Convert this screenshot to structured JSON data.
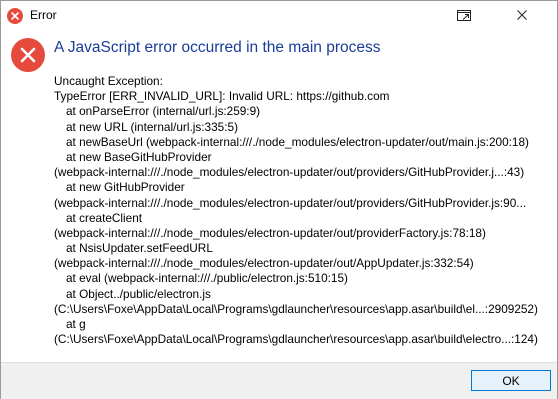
{
  "window": {
    "title": "Error",
    "accent_color": "#e64a3c"
  },
  "dialog": {
    "heading": "A JavaScript error occurred in the main process",
    "heading_color": "#1a3c99",
    "lines": [
      "Uncaught Exception:",
      "TypeError [ERR_INVALID_URL]: Invalid URL: https://github.com",
      "at onParseError (internal/url.js:259:9)",
      "at new URL (internal/url.js:335:5)",
      "at newBaseUrl (webpack-internal:///./node_modules/electron-updater/out/main.js:200:18)",
      "at new BaseGitHubProvider",
      "(webpack-internal:///./node_modules/electron-updater/out/providers/GitHubProvider.j...:43)",
      "at new GitHubProvider",
      "(webpack-internal:///./node_modules/electron-updater/out/providers/GitHubProvider.js:90...",
      "at createClient",
      "(webpack-internal:///./node_modules/electron-updater/out/providerFactory.js:78:18)",
      "at NsisUpdater.setFeedURL",
      "(webpack-internal:///./node_modules/electron-updater/out/AppUpdater.js:332:54)",
      "at eval (webpack-internal:///./public/electron.js:510:15)",
      "at Object../public/electron.js",
      "(C:\\Users\\Foxe\\AppData\\Local\\Programs\\gdlauncher\\resources\\app.asar\\build\\el...:2909252)",
      "at g",
      "(C:\\Users\\Foxe\\AppData\\Local\\Programs\\gdlauncher\\resources\\app.asar\\build\\electro...:124)"
    ]
  },
  "footer": {
    "ok_label": "OK"
  }
}
